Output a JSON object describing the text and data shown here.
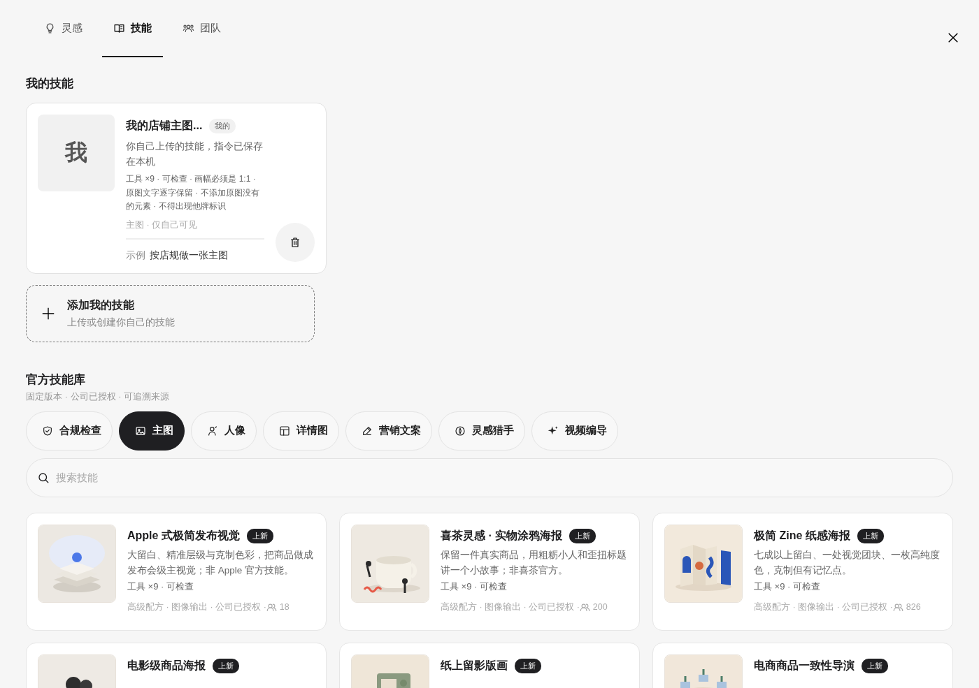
{
  "tabs": [
    {
      "label": "灵感",
      "selected": false
    },
    {
      "label": "技能",
      "selected": true
    },
    {
      "label": "团队",
      "selected": false
    }
  ],
  "my_skills": {
    "title": "我的技能",
    "cards": [
      {
        "avatar_text": "我",
        "title": "我的店铺主图...",
        "badge": "我的",
        "description": "你自己上传的技能，指令已保存在本机",
        "details": "工具 ×9 · 可检查 · 画幅必须是 1:1 · 原图文字逐字保留 · 不添加原图没有的元素 · 不得出现他牌标识",
        "meta": "主图 · 仅自己可见",
        "example_label": "示例",
        "example": "按店规做一张主图"
      }
    ],
    "add": {
      "title": "添加我的技能",
      "subtitle": "上传或创建你自己的技能"
    }
  },
  "library": {
    "title": "官方技能库",
    "subtitle": "固定版本 · 公司已授权 · 可追溯来源",
    "categories": [
      {
        "label": "合规检查",
        "selected": false
      },
      {
        "label": "主图",
        "selected": true
      },
      {
        "label": "人像",
        "selected": false
      },
      {
        "label": "详情图",
        "selected": false
      },
      {
        "label": "营销文案",
        "selected": false
      },
      {
        "label": "灵感猎手",
        "selected": false
      },
      {
        "label": "视频编导",
        "selected": false
      }
    ],
    "search": {
      "placeholder": "搜索技能"
    },
    "skills": [
      {
        "title": "Apple 式极简发布视觉",
        "badge": "上新",
        "description": "大留白、精准层级与克制色彩，把商品做成发布会级主视觉；非 Apple 官方技能。",
        "details": "工具 ×9 · 可检查",
        "meta": "高级配方 · 图像输出 · 公司已授权 · ",
        "users": "18"
      },
      {
        "title": "喜茶灵感 · 实物涂鸦海报",
        "badge": "上新",
        "description": "保留一件真实商品，用粗粝小人和歪扭标题讲一个小故事；非喜茶官方。",
        "details": "工具 ×9 · 可检查",
        "meta": "高级配方 · 图像输出 · 公司已授权 · ",
        "users": "200"
      },
      {
        "title": "极简 Zine 纸感海报",
        "badge": "上新",
        "description": "七成以上留白、一处视觉团块、一枚高纯度色，克制但有记忆点。",
        "details": "工具 ×9 · 可检查",
        "meta": "高级配方 · 图像输出 · 公司已授权 · ",
        "users": "826"
      },
      {
        "title": "电影级商品海报",
        "badge": "上新"
      },
      {
        "title": "纸上留影版画",
        "badge": "上新"
      },
      {
        "title": "电商商品一致性导演",
        "badge": "上新"
      }
    ]
  }
}
